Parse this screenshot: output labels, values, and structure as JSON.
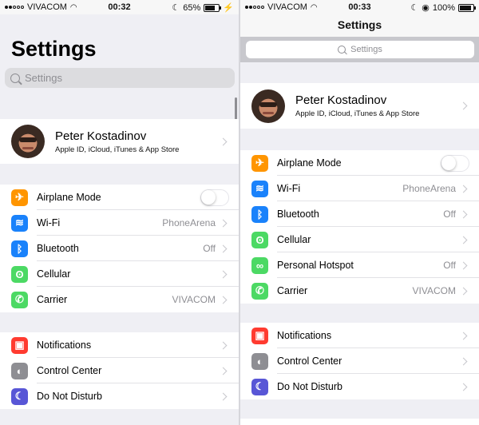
{
  "left": {
    "status": {
      "carrier": "VIVACOM",
      "time": "00:32",
      "battery": "65%",
      "battery_level": 0.65
    },
    "title": "Settings",
    "search_placeholder": "Settings",
    "profile": {
      "name": "Peter Kostadinov",
      "subtitle": "Apple ID, iCloud, iTunes & App Store"
    },
    "group1": [
      {
        "label": "Airplane Mode",
        "icon": "airplane-icon",
        "color": "#ff9500",
        "toggle": true
      },
      {
        "label": "Wi-Fi",
        "icon": "wifi-icon",
        "color": "#1a82fb",
        "value": "PhoneArena"
      },
      {
        "label": "Bluetooth",
        "icon": "bluetooth-icon",
        "color": "#1a82fb",
        "value": "Off"
      },
      {
        "label": "Cellular",
        "icon": "cellular-icon",
        "color": "#4cd964"
      },
      {
        "label": "Carrier",
        "icon": "phone-icon",
        "color": "#4cd964",
        "value": "VIVACOM"
      }
    ],
    "group2": [
      {
        "label": "Notifications",
        "icon": "notifications-icon",
        "color": "#ff3b30"
      },
      {
        "label": "Control Center",
        "icon": "control-center-icon",
        "color": "#8e8e93"
      },
      {
        "label": "Do Not Disturb",
        "icon": "moon-icon",
        "color": "#5856d6"
      }
    ]
  },
  "right": {
    "status": {
      "carrier": "VIVACOM",
      "time": "00:33",
      "battery": "100%",
      "battery_level": 1.0
    },
    "title": "Settings",
    "search_placeholder": "Settings",
    "profile": {
      "name": "Peter Kostadinov",
      "subtitle": "Apple ID, iCloud, iTunes & App Store"
    },
    "group1": [
      {
        "label": "Airplane Mode",
        "icon": "airplane-icon",
        "color": "#ff9500",
        "toggle": true
      },
      {
        "label": "Wi-Fi",
        "icon": "wifi-icon",
        "color": "#1a82fb",
        "value": "PhoneArena"
      },
      {
        "label": "Bluetooth",
        "icon": "bluetooth-icon",
        "color": "#1a82fb",
        "value": "Off"
      },
      {
        "label": "Cellular",
        "icon": "cellular-icon",
        "color": "#4cd964"
      },
      {
        "label": "Personal Hotspot",
        "icon": "hotspot-icon",
        "color": "#4cd964",
        "value": "Off"
      },
      {
        "label": "Carrier",
        "icon": "phone-icon",
        "color": "#4cd964",
        "value": "VIVACOM"
      }
    ],
    "group2": [
      {
        "label": "Notifications",
        "icon": "notifications-icon",
        "color": "#ff3b30"
      },
      {
        "label": "Control Center",
        "icon": "control-center-icon",
        "color": "#8e8e93"
      },
      {
        "label": "Do Not Disturb",
        "icon": "moon-icon",
        "color": "#5856d6"
      }
    ]
  }
}
